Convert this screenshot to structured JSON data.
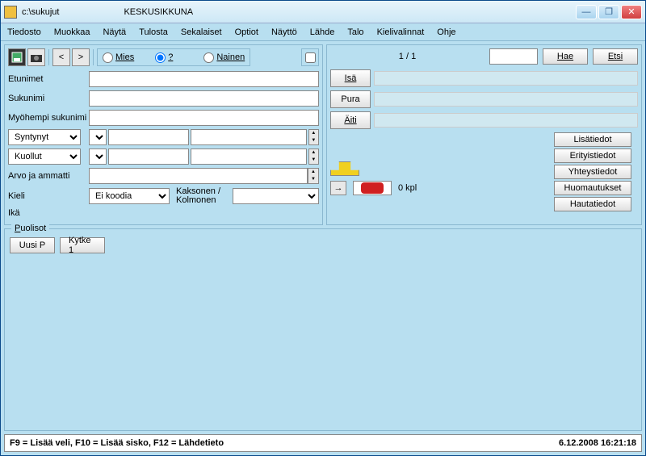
{
  "title": {
    "path": "c:\\sukujut",
    "name": "KESKUSIKKUNA"
  },
  "menu": [
    "Tiedosto",
    "Muokkaa",
    "Näytä",
    "Tulosta",
    "Sekalaiset",
    "Optiot",
    "Näyttö",
    "Lähde",
    "Talo",
    "Kielivalinnat",
    "Ohje"
  ],
  "gender": {
    "male": "Mies",
    "unknown": "?",
    "female": "Nainen"
  },
  "labels": {
    "firstnames": "Etunimet",
    "surname": "Sukunimi",
    "later_surname": "Myöhempi sukunimi",
    "born": "Syntynyt",
    "died": "Kuollut",
    "title_occ": "Arvo ja ammatti",
    "language": "Kieli",
    "age": "Ikä",
    "twin": "Kaksonen / Kolmonen",
    "spouses": "Puolisot"
  },
  "language_value": "Ei koodia",
  "right": {
    "counter": "1 / 1",
    "search": "Hae",
    "find": "Etsi",
    "father": "Isä",
    "dissolve": "Pura",
    "mother": "Äiti",
    "count_kpl": "0 kpl",
    "info_buttons": [
      "Lisätiedot",
      "Erityistiedot",
      "Yhteystiedot",
      "Huomautukset",
      "Hautatiedot"
    ]
  },
  "spouse_buttons": {
    "new": "Uusi P",
    "link": "Kytke 1"
  },
  "status": {
    "hint": "F9 = Lisää veli, F10 = Lisää sisko, F12 = Lähdetieto",
    "datetime": "6.12.2008 16:21:18"
  }
}
